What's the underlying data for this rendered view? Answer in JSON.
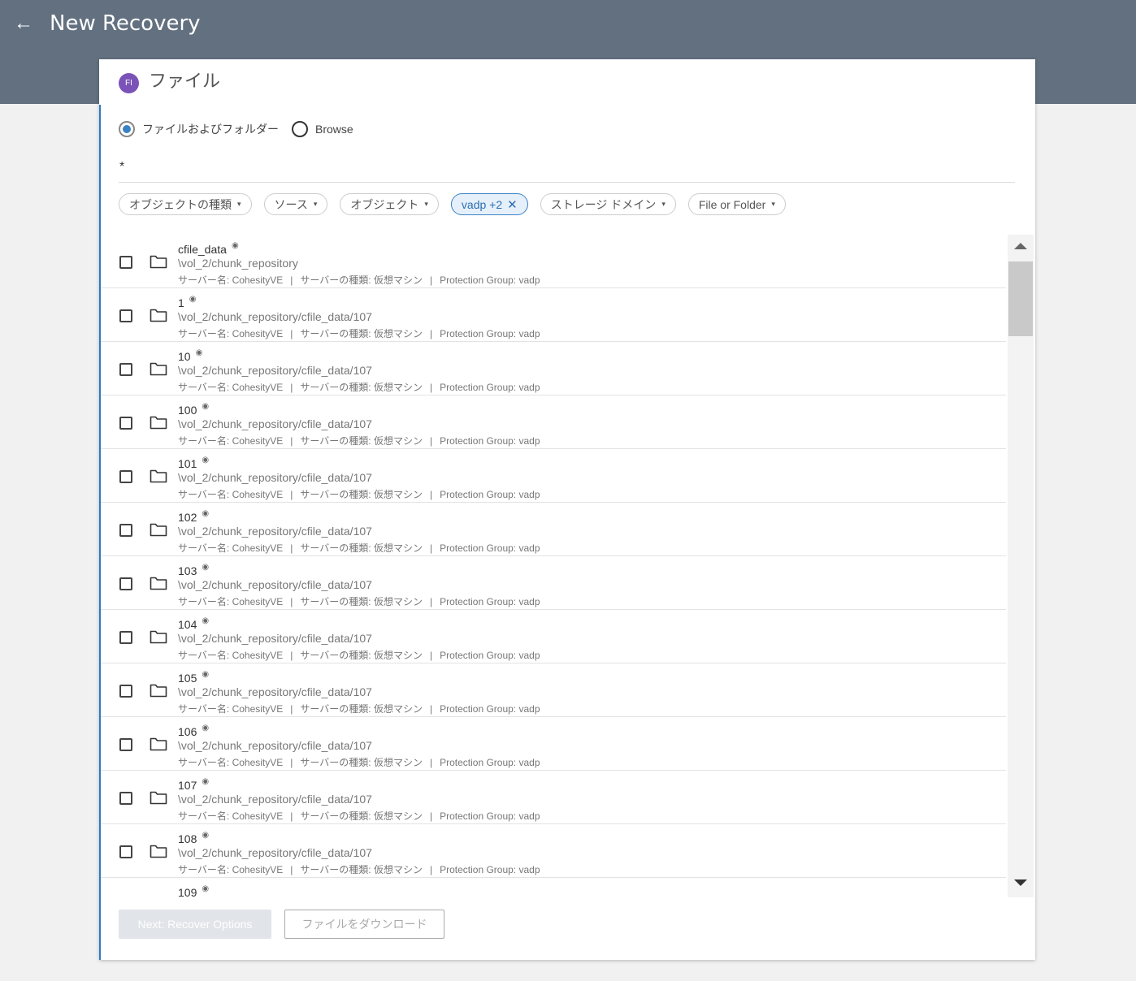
{
  "header": {
    "title": "New Recovery",
    "back_icon": "arrow-left-icon"
  },
  "card": {
    "badge": "FI",
    "title": "ファイル"
  },
  "mode": {
    "option1": "ファイルおよびフォルダー",
    "option2": "Browse",
    "selected": "option1"
  },
  "search": {
    "value": "*"
  },
  "filters": [
    {
      "label": "オブジェクトの種類",
      "active": false
    },
    {
      "label": "ソース",
      "active": false
    },
    {
      "label": "オブジェクト",
      "active": false
    },
    {
      "label": "vadp +2",
      "active": true
    },
    {
      "label": "ストレージ ドメイン",
      "active": false
    },
    {
      "label": "File or Folder",
      "active": false
    }
  ],
  "rows": [
    {
      "name": "cfile_data",
      "path": "\\vol_2/chunk_repository",
      "server_label": "サーバー名:",
      "server": "CohesityVE",
      "type_label": "サーバーの種類:",
      "type": "仮想マシン",
      "pg_label": "Protection Group:",
      "pg": "vadp"
    },
    {
      "name": "1",
      "path": "\\vol_2/chunk_repository/cfile_data/107",
      "server_label": "サーバー名:",
      "server": "CohesityVE",
      "type_label": "サーバーの種類:",
      "type": "仮想マシン",
      "pg_label": "Protection Group:",
      "pg": "vadp"
    },
    {
      "name": "10",
      "path": "\\vol_2/chunk_repository/cfile_data/107",
      "server_label": "サーバー名:",
      "server": "CohesityVE",
      "type_label": "サーバーの種類:",
      "type": "仮想マシン",
      "pg_label": "Protection Group:",
      "pg": "vadp"
    },
    {
      "name": "100",
      "path": "\\vol_2/chunk_repository/cfile_data/107",
      "server_label": "サーバー名:",
      "server": "CohesityVE",
      "type_label": "サーバーの種類:",
      "type": "仮想マシン",
      "pg_label": "Protection Group:",
      "pg": "vadp"
    },
    {
      "name": "101",
      "path": "\\vol_2/chunk_repository/cfile_data/107",
      "server_label": "サーバー名:",
      "server": "CohesityVE",
      "type_label": "サーバーの種類:",
      "type": "仮想マシン",
      "pg_label": "Protection Group:",
      "pg": "vadp"
    },
    {
      "name": "102",
      "path": "\\vol_2/chunk_repository/cfile_data/107",
      "server_label": "サーバー名:",
      "server": "CohesityVE",
      "type_label": "サーバーの種類:",
      "type": "仮想マシン",
      "pg_label": "Protection Group:",
      "pg": "vadp"
    },
    {
      "name": "103",
      "path": "\\vol_2/chunk_repository/cfile_data/107",
      "server_label": "サーバー名:",
      "server": "CohesityVE",
      "type_label": "サーバーの種類:",
      "type": "仮想マシン",
      "pg_label": "Protection Group:",
      "pg": "vadp"
    },
    {
      "name": "104",
      "path": "\\vol_2/chunk_repository/cfile_data/107",
      "server_label": "サーバー名:",
      "server": "CohesityVE",
      "type_label": "サーバーの種類:",
      "type": "仮想マシン",
      "pg_label": "Protection Group:",
      "pg": "vadp"
    },
    {
      "name": "105",
      "path": "\\vol_2/chunk_repository/cfile_data/107",
      "server_label": "サーバー名:",
      "server": "CohesityVE",
      "type_label": "サーバーの種類:",
      "type": "仮想マシン",
      "pg_label": "Protection Group:",
      "pg": "vadp"
    },
    {
      "name": "106",
      "path": "\\vol_2/chunk_repository/cfile_data/107",
      "server_label": "サーバー名:",
      "server": "CohesityVE",
      "type_label": "サーバーの種類:",
      "type": "仮想マシン",
      "pg_label": "Protection Group:",
      "pg": "vadp"
    },
    {
      "name": "107",
      "path": "\\vol_2/chunk_repository/cfile_data/107",
      "server_label": "サーバー名:",
      "server": "CohesityVE",
      "type_label": "サーバーの種類:",
      "type": "仮想マシン",
      "pg_label": "Protection Group:",
      "pg": "vadp"
    },
    {
      "name": "108",
      "path": "\\vol_2/chunk_repository/cfile_data/107",
      "server_label": "サーバー名:",
      "server": "CohesityVE",
      "type_label": "サーバーの種類:",
      "type": "仮想マシン",
      "pg_label": "Protection Group:",
      "pg": "vadp"
    },
    {
      "name": "109",
      "path": "",
      "server_label": "",
      "server": "",
      "type_label": "",
      "type": "",
      "pg_label": "",
      "pg": ""
    }
  ],
  "footer": {
    "next_label": "Next: Recover Options",
    "download_label": "ファイルをダウンロード"
  },
  "colors": {
    "header_bg": "#627080",
    "accent": "#3a82c4",
    "badge": "#7a52b8"
  }
}
